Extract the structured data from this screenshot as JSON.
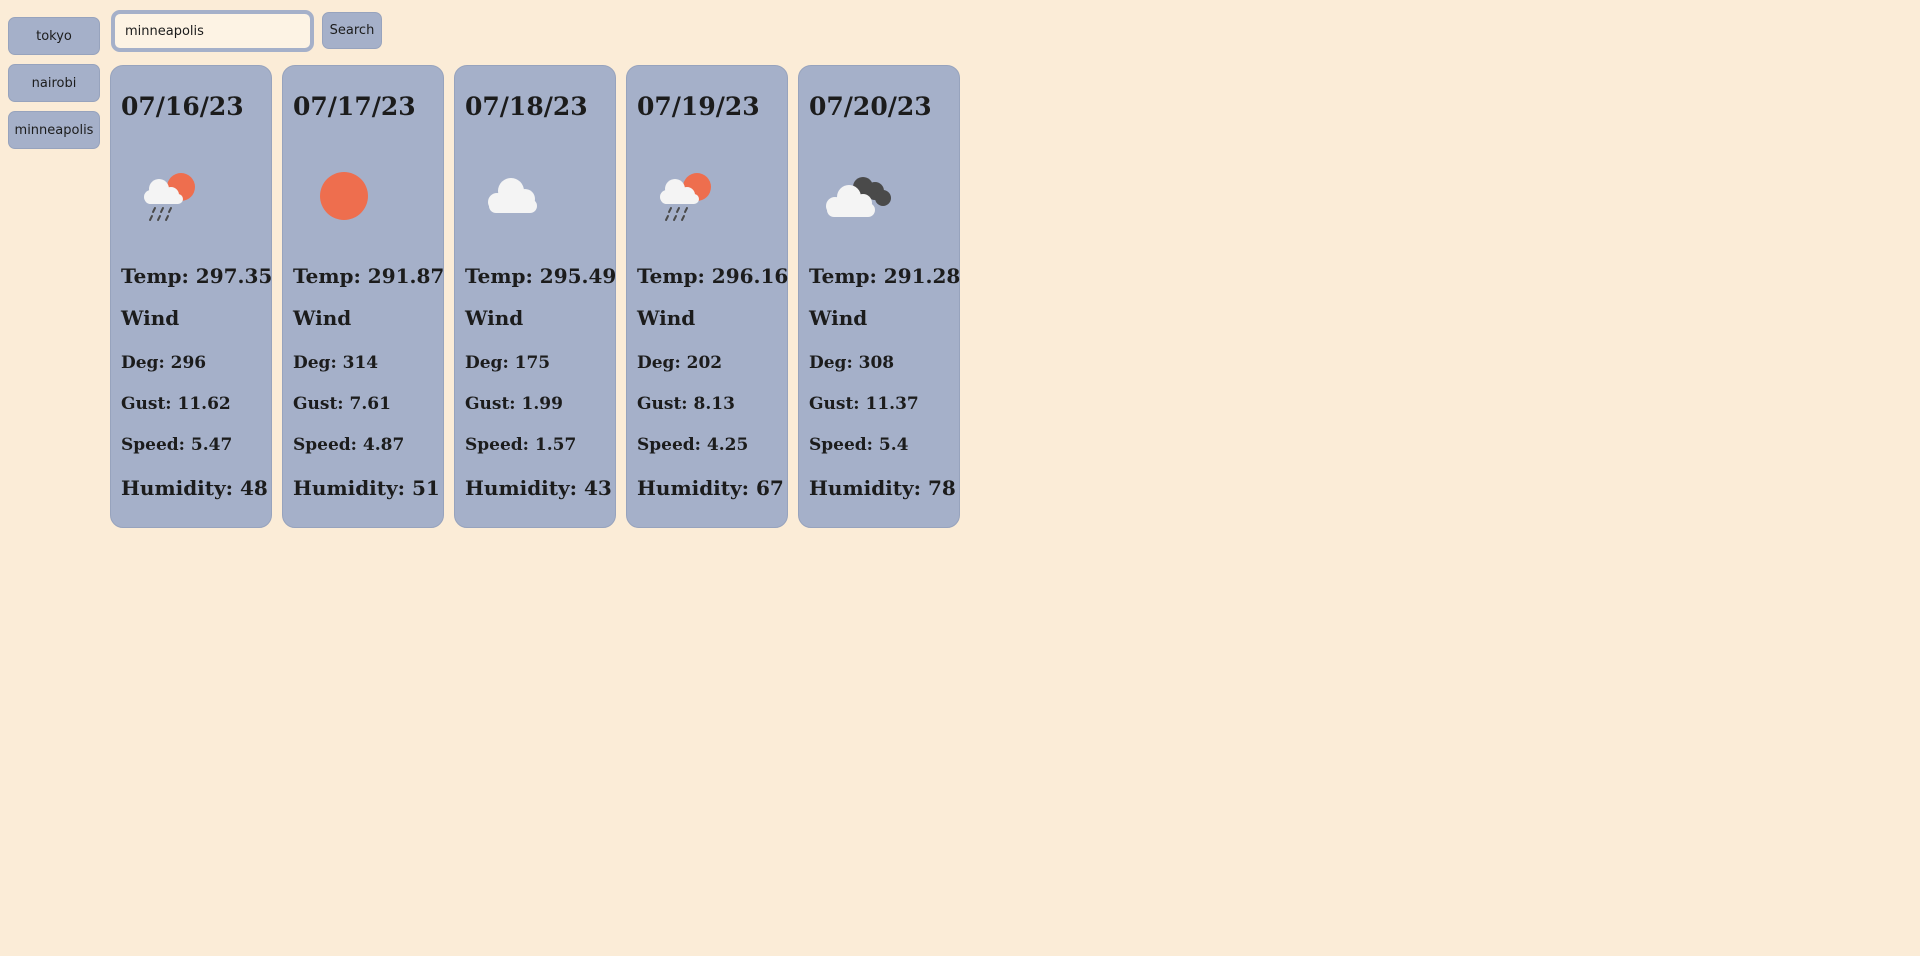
{
  "history": [
    "tokyo",
    "nairobi",
    "minneapolis"
  ],
  "search": {
    "value": "minneapolis",
    "button_label": "Search"
  },
  "colors": {
    "background": "#fbecd7",
    "card": "#a5b0c9",
    "sun": "#ee6e4e",
    "cloud_light": "#f4f4f4",
    "cloud_dark": "#4a4a4a"
  },
  "forecast": [
    {
      "date": "07/16/23",
      "icon": "rain-sun-icon",
      "temp": "Temp: 297.35",
      "wind_label": "Wind",
      "deg": "Deg: 296",
      "gust": "Gust: 11.62",
      "speed": "Speed: 5.47",
      "humidity": "Humidity: 48"
    },
    {
      "date": "07/17/23",
      "icon": "sun-icon",
      "temp": "Temp: 291.87",
      "wind_label": "Wind",
      "deg": "Deg: 314",
      "gust": "Gust: 7.61",
      "speed": "Speed: 4.87",
      "humidity": "Humidity: 51"
    },
    {
      "date": "07/18/23",
      "icon": "cloud-icon",
      "temp": "Temp: 295.49",
      "wind_label": "Wind",
      "deg": "Deg: 175",
      "gust": "Gust: 1.99",
      "speed": "Speed: 1.57",
      "humidity": "Humidity: 43"
    },
    {
      "date": "07/19/23",
      "icon": "rain-sun-icon",
      "temp": "Temp: 296.16",
      "wind_label": "Wind",
      "deg": "Deg: 202",
      "gust": "Gust: 8.13",
      "speed": "Speed: 4.25",
      "humidity": "Humidity: 67"
    },
    {
      "date": "07/20/23",
      "icon": "broken-clouds-icon",
      "temp": "Temp: 291.28",
      "wind_label": "Wind",
      "deg": "Deg: 308",
      "gust": "Gust: 11.37",
      "speed": "Speed: 5.4",
      "humidity": "Humidity: 78"
    }
  ]
}
